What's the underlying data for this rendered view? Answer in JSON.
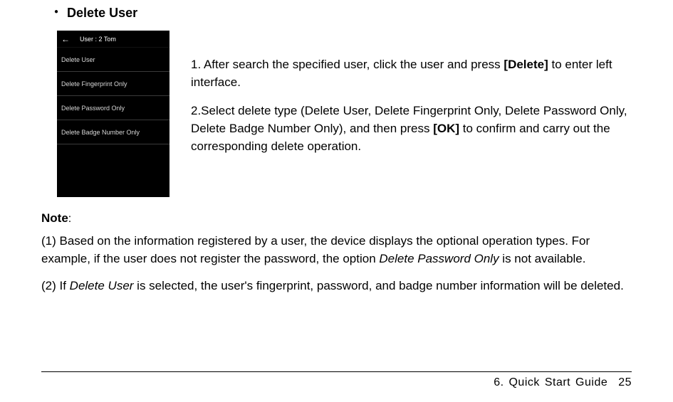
{
  "heading": "Delete User",
  "device": {
    "title": "User : 2 Tom",
    "items": [
      "Delete User",
      "Delete Fingerprint Only",
      "Delete Password Only",
      "Delete Badge Number Only"
    ]
  },
  "steps": {
    "s1_a": "1. After search the specified user, click the user and press ",
    "s1_b": "[Delete]",
    "s1_c": " to enter left interface.",
    "s2_a": "2.Select delete type (Delete User, Delete Fingerprint Only, Delete Password Only, Delete Badge Number Only), and then press ",
    "s2_b": "[OK]",
    "s2_c": " to confirm and carry out the corresponding delete operation."
  },
  "note_label": "Note",
  "note_colon": ":",
  "notes": {
    "n1_a": "(1) Based on the information registered by a user, the device displays the optional operation types. For example, if the user does not register the password, the option ",
    "n1_b": "Delete Password Only",
    "n1_c": " is not available.",
    "n2_a": "(2) If ",
    "n2_b": "Delete User",
    "n2_c": " is selected, the user's fingerprint, password, and badge number information will be deleted."
  },
  "footer": {
    "chapter": "6.  Quick  Start  Guide",
    "page": "25"
  }
}
